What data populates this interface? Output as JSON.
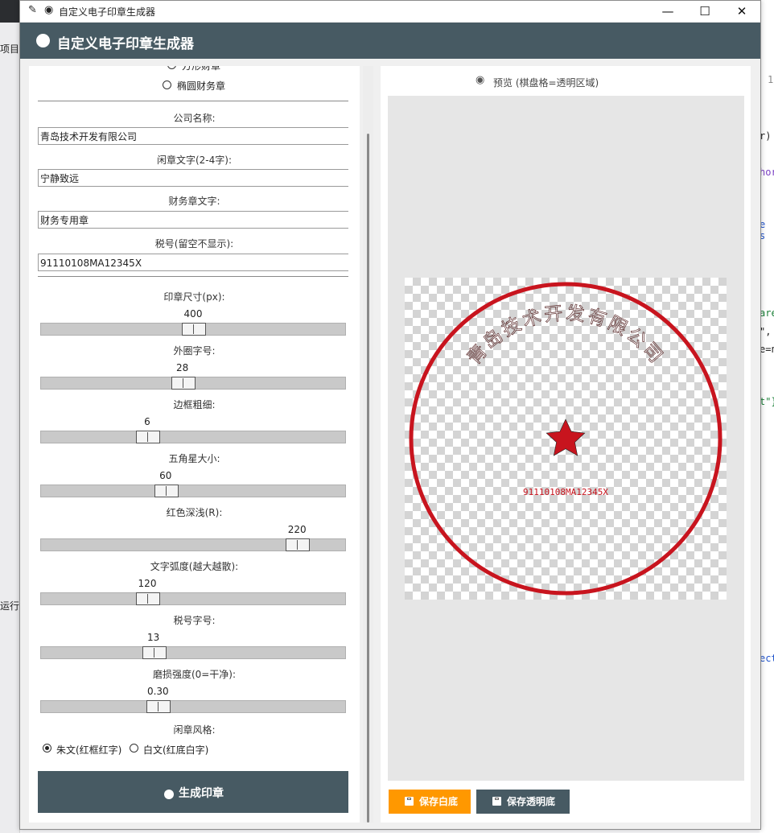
{
  "window": {
    "title": "自定义电子印章生成器"
  },
  "header": {
    "title": "自定义电子印章生成器"
  },
  "background_app": {
    "left_items": [
      "项目",
      "运行"
    ],
    "right_fragments": [
      "1/",
      "r)",
      "hor",
      "e s",
      "are",
      "\",",
      "e=n",
      "t\"}",
      "ect"
    ]
  },
  "form": {
    "radio_partial": "方形财章",
    "radio_oval": "椭圆财务章",
    "company_label": "公司名称:",
    "company_value": "青岛技术开发有限公司",
    "leisure_label": "闲章文字(2-4字):",
    "leisure_value": "宁静致远",
    "finance_label": "财务章文字:",
    "finance_value": "财务专用章",
    "tax_label": "税号(留空不显示):",
    "tax_value": "91110108MA12345X"
  },
  "sliders": [
    {
      "label": "印章尺寸(px):",
      "value": "400",
      "fraction": 0.5
    },
    {
      "label": "外圈字号:",
      "value": "28",
      "fraction": 0.465
    },
    {
      "label": "边框粗细:",
      "value": "6",
      "fraction": 0.35
    },
    {
      "label": "五角星大小:",
      "value": "60",
      "fraction": 0.41
    },
    {
      "label": "红色深浅(R):",
      "value": "220",
      "fraction": 0.84
    },
    {
      "label": "文字弧度(越大越散):",
      "value": "120",
      "fraction": 0.35
    },
    {
      "label": "税号字号:",
      "value": "13",
      "fraction": 0.37
    },
    {
      "label": "磨损强度(0=干净):",
      "value": "0.30",
      "fraction": 0.385
    }
  ],
  "style": {
    "label": "闲章风格:",
    "option1": "朱文(红框红字)",
    "option2": "白文(红底白字)",
    "selected": "option1"
  },
  "generate_button": "生成印章",
  "preview": {
    "title": "预览 (棋盘格=透明区域)",
    "seal_text": "青岛技术开发有限公司",
    "seal_tax": "91110108MA12345X",
    "seal_color": "#c8141e"
  },
  "buttons": {
    "save_white": "保存白底",
    "save_transparent": "保存透明底"
  },
  "colors": {
    "header": "#475a63",
    "save_white": "#ff9800",
    "save_transparent": "#475a63"
  }
}
